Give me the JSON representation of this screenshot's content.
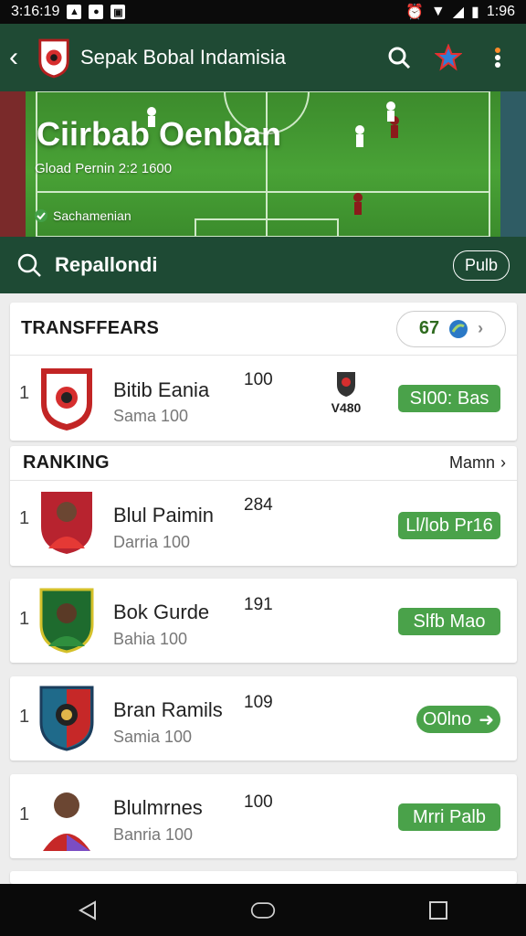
{
  "status_bar": {
    "time": "3:16:19",
    "right_time": "1:96",
    "icons": [
      "image-icon",
      "settings-icon",
      "gallery-icon"
    ]
  },
  "app_bar": {
    "title": "Sepak Bobal Indamisia",
    "back_icon": "back-icon",
    "search_icon": "search-icon",
    "star_icon": "star-icon",
    "more_icon": "more-icon"
  },
  "hero": {
    "title": "Ciirbab Oenban",
    "subtitle": "Gload Pernin 2:2 1600",
    "caption": "Sachamenian"
  },
  "search": {
    "label": "Repallondi",
    "button": "Pulb"
  },
  "transfers": {
    "title": "TRANSFFEARS",
    "filter_value": "67",
    "row": {
      "rank": "1",
      "name": "Bitib Eania",
      "sub": "Sama 100",
      "score": "100",
      "badge_text": "V480",
      "tag": "SI00: Bas"
    }
  },
  "ranking": {
    "title": "RANKING",
    "more_label": "Mamn",
    "items": [
      {
        "rank": "1",
        "name": "Blul Paimin",
        "sub": "Darria 100",
        "score": "284",
        "tag": "Ll/lob Pr16"
      },
      {
        "rank": "1",
        "name": "Bok Gurde",
        "sub": "Bahia 100",
        "score": "191",
        "tag": "Slfb Mao"
      },
      {
        "rank": "1",
        "name": "Bran Ramils",
        "sub": "Samia 100",
        "score": "109",
        "tag": "O0lno"
      },
      {
        "rank": "1",
        "name": "Blulmrnes",
        "sub": "Banria 100",
        "score": "100",
        "tag": "Mrri Palb"
      }
    ]
  },
  "colors": {
    "primary": "#1f4a34",
    "accent": "#4aa24a",
    "field_green": "#49a236",
    "background": "#ededed"
  }
}
